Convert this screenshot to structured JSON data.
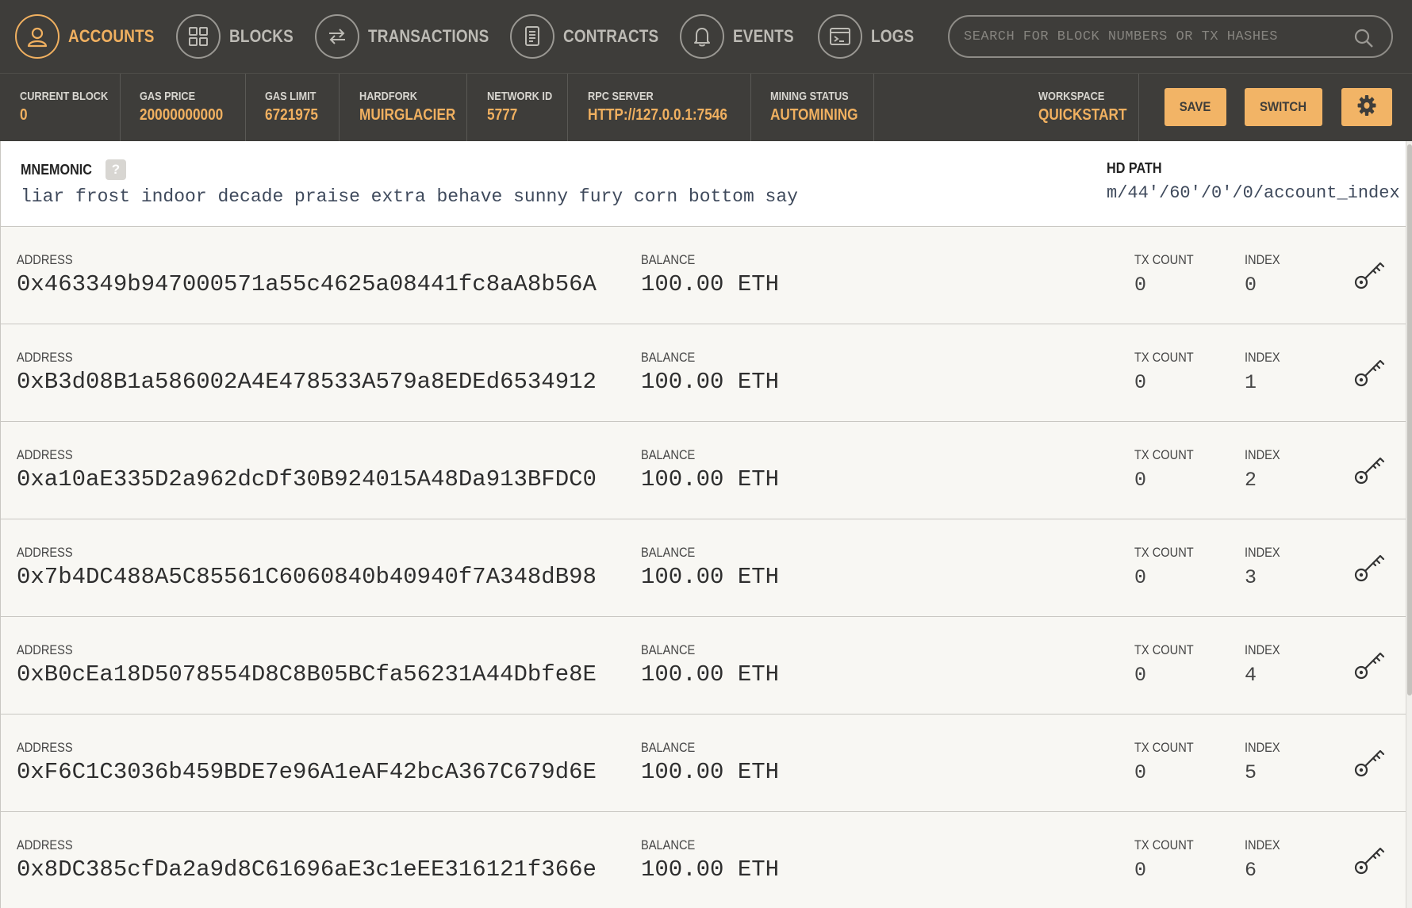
{
  "nav": {
    "items": [
      {
        "label": "ACCOUNTS",
        "icon": "user-icon",
        "active": true
      },
      {
        "label": "BLOCKS",
        "icon": "blocks-grid-icon",
        "active": false
      },
      {
        "label": "TRANSACTIONS",
        "icon": "swap-arrows-icon",
        "active": false
      },
      {
        "label": "CONTRACTS",
        "icon": "document-icon",
        "active": false
      },
      {
        "label": "EVENTS",
        "icon": "bell-icon",
        "active": false
      },
      {
        "label": "LOGS",
        "icon": "terminal-icon",
        "active": false
      }
    ],
    "search_placeholder": "SEARCH FOR BLOCK NUMBERS OR TX HASHES"
  },
  "status": {
    "current_block": {
      "label": "CURRENT BLOCK",
      "value": "0"
    },
    "gas_price": {
      "label": "GAS PRICE",
      "value": "20000000000"
    },
    "gas_limit": {
      "label": "GAS LIMIT",
      "value": "6721975"
    },
    "hardfork": {
      "label": "HARDFORK",
      "value": "MUIRGLACIER"
    },
    "network_id": {
      "label": "NETWORK ID",
      "value": "5777"
    },
    "rpc_server": {
      "label": "RPC SERVER",
      "value": "HTTP://127.0.0.1:7546"
    },
    "mining_status": {
      "label": "MINING STATUS",
      "value": "AUTOMINING"
    },
    "workspace": {
      "label": "WORKSPACE",
      "value": "QUICKSTART"
    },
    "save_label": "SAVE",
    "switch_label": "SWITCH"
  },
  "mnemonic": {
    "title": "MNEMONIC",
    "help": "?",
    "phrase": "liar frost indoor decade praise extra behave sunny fury corn bottom say",
    "hd_path_title": "HD PATH",
    "hd_path": "m/44'/60'/0'/0/account_index"
  },
  "account_labels": {
    "address": "ADDRESS",
    "balance": "BALANCE",
    "tx_count": "TX COUNT",
    "index": "INDEX"
  },
  "accounts": [
    {
      "address": "0x463349b947000571a55c4625a08441fc8aA8b56A",
      "balance": "100.00 ETH",
      "tx_count": "0",
      "index": "0"
    },
    {
      "address": "0xB3d08B1a586002A4E478533A579a8EDEd6534912",
      "balance": "100.00 ETH",
      "tx_count": "0",
      "index": "1"
    },
    {
      "address": "0xa10aE335D2a962dcDf30B924015A48Da913BFDC0",
      "balance": "100.00 ETH",
      "tx_count": "0",
      "index": "2"
    },
    {
      "address": "0x7b4DC488A5C85561C6060840b40940f7A348dB98",
      "balance": "100.00 ETH",
      "tx_count": "0",
      "index": "3"
    },
    {
      "address": "0xB0cEa18D5078554D8C8B05BCfa56231A44Dbfe8E",
      "balance": "100.00 ETH",
      "tx_count": "0",
      "index": "4"
    },
    {
      "address": "0xF6C1C3036b459BDE7e96A1eAF42bcA367C679d6E",
      "balance": "100.00 ETH",
      "tx_count": "0",
      "index": "5"
    },
    {
      "address": "0x8DC385cfDa2a9d8C61696aE3c1eEE316121f366e",
      "balance": "100.00 ETH",
      "tx_count": "0",
      "index": "6"
    }
  ],
  "colors": {
    "header_bg": "#3e3d3a",
    "accent": "#f0b060",
    "button": "#f2b466",
    "row_bg": "#f8f7f3"
  }
}
